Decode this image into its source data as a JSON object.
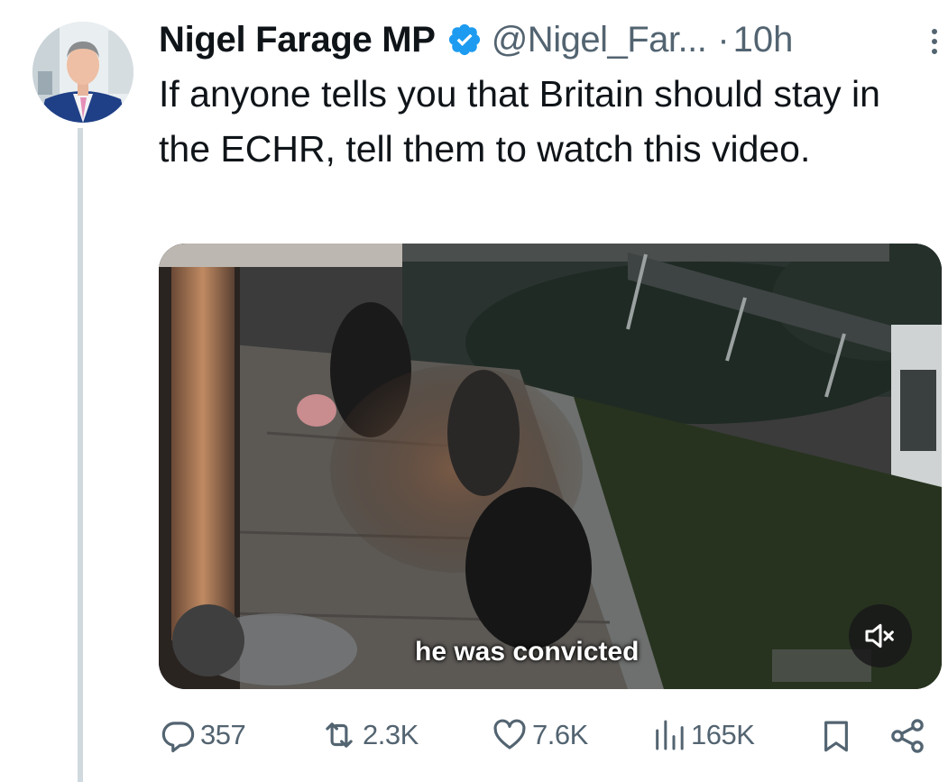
{
  "tweet": {
    "author_name": "Nigel Farage MP",
    "handle": "@Nigel_Far...",
    "separator": "·",
    "time": "10h",
    "text": "If anyone tells you that Britain should stay in the ECHR, tell them to watch this video.",
    "verified_color": "#1d9bf0"
  },
  "media": {
    "caption": "he was convicted",
    "mute_icon": "volume-muted-icon"
  },
  "actions": {
    "replies": "357",
    "reposts": "2.3K",
    "likes": "7.6K",
    "views": "165K"
  },
  "icons": {
    "more": "more-vertical-icon",
    "reply": "reply-icon",
    "repost": "repost-icon",
    "like": "heart-icon",
    "views": "views-chart-icon",
    "bookmark": "bookmark-icon",
    "share": "share-icon"
  }
}
